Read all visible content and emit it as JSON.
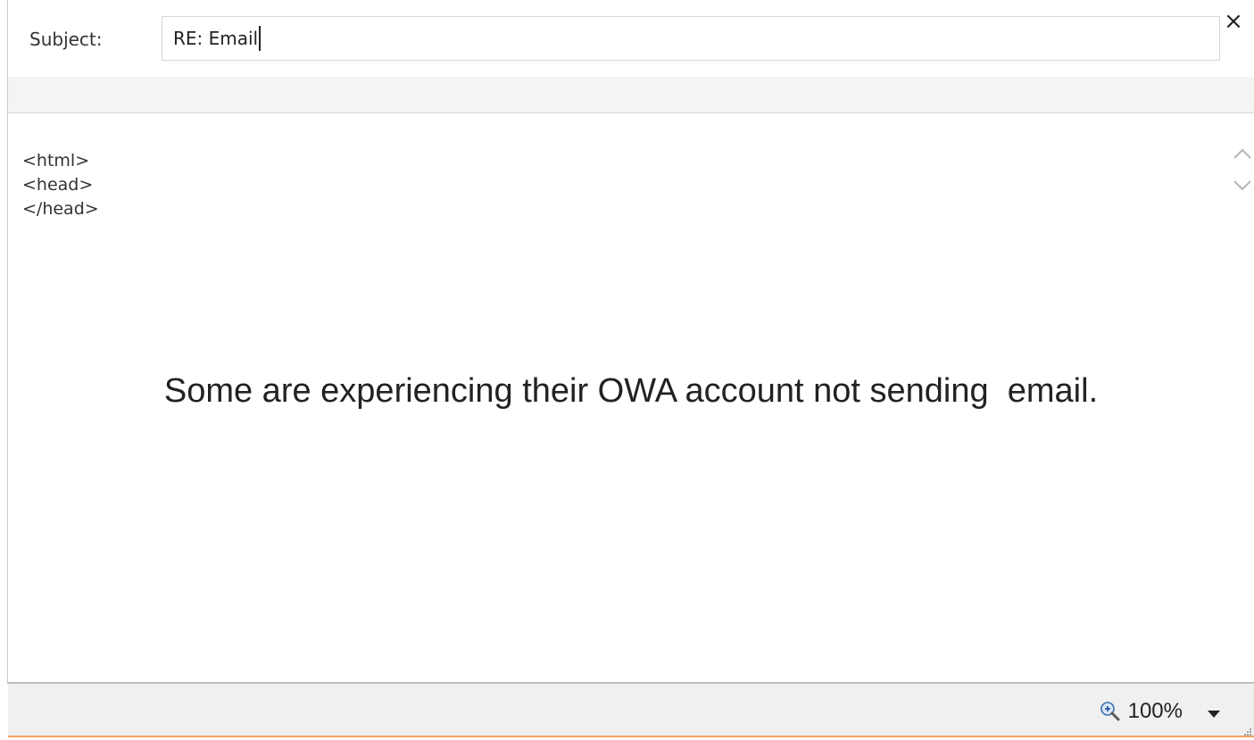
{
  "subject": {
    "label": "Subject:",
    "value": "RE: Email",
    "close_symbol": "×"
  },
  "body": {
    "code_lines": [
      "<html>",
      "<head>",
      "</head>"
    ],
    "message": "Some are experiencing their OWA account not sending  email."
  },
  "status_bar": {
    "zoom_value": "100%"
  },
  "icons": {
    "close": "close-icon",
    "scroll_up": "chevron-up-icon",
    "scroll_down": "chevron-down-icon",
    "zoom": "zoom-in-icon",
    "dropdown": "caret-down-icon",
    "grip": "resize-grip-icon"
  },
  "colors": {
    "accent_line": "#f0a060",
    "band": "#f4f4f4",
    "status_bg": "#f0f0f0"
  }
}
